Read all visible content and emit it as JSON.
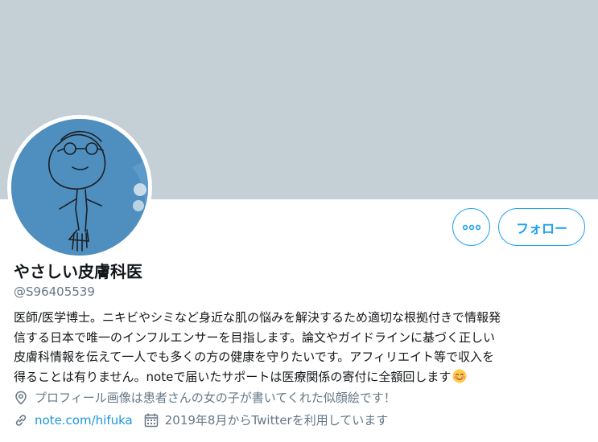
{
  "profile": {
    "display_name": "やさしい皮膚科医",
    "handle": "@S96405539",
    "bio_lines": [
      "医師/医学博士。ニキビやシミなど身近な肌の悩みを解決するため適切な根拠付きで情報発",
      "信する日本で唯一のインフルエンサーを目指します。論文やガイドラインに基づく正しい",
      "皮膚科情報を伝えて一人でも多くの方の健康を守りたいです。アフィリエイト等で収入を",
      "得ることは有りません。noteで届いたサポートは医療関係の寄付に全額回します"
    ],
    "bio_emoji": "smiling-face-with-blush-emoji",
    "location": "プロフィール画像は患者さんの女の子が書いてくれた似顔絵です！",
    "website": "note.com/hifuka",
    "joined": "2019年8月からTwitterを利用しています"
  },
  "actions": {
    "more_icon": "more-dots-icon",
    "follow_label": "フォロー"
  },
  "icons": {
    "location": "location-pin-icon",
    "website": "link-icon",
    "joined": "calendar-icon"
  },
  "colors": {
    "banner": "#c4cfd6",
    "accent": "#1da1f2",
    "link": "#1b95e0",
    "secondary_text": "#657786",
    "avatar_background": "#4f8fbf"
  }
}
